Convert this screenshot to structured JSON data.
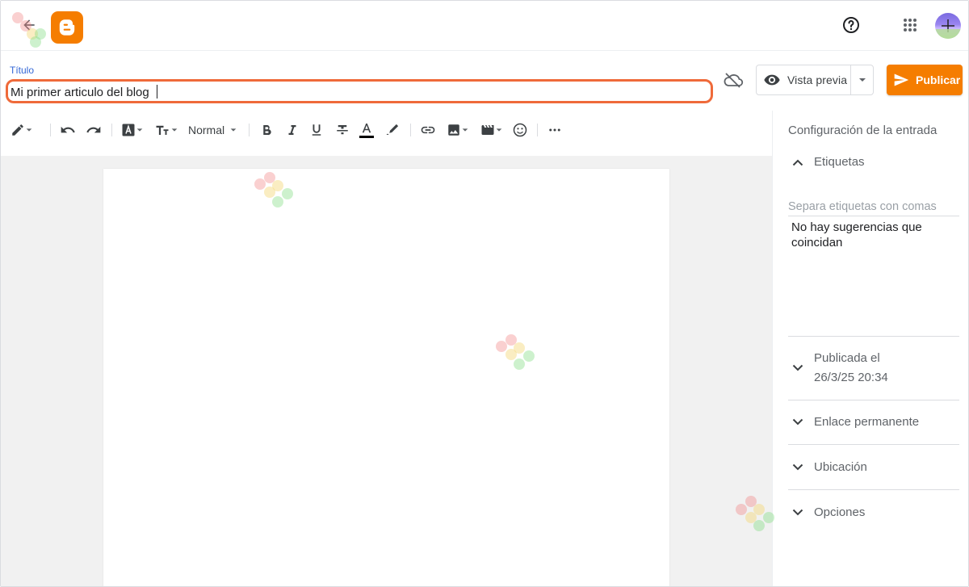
{
  "header": {
    "back_icon": "arrow-left-icon",
    "logo_icon": "blogger-logo-icon",
    "help_icon": "help-circle-icon",
    "apps_icon": "apps-grid-icon",
    "avatar_icon": "user-avatar"
  },
  "title_field": {
    "label": "Título",
    "value": "Mi primer articulo del blog",
    "highlight_color": "#ef6a3a"
  },
  "actions": {
    "cloud_icon": "cloud-off-icon",
    "preview_label": "Vista previa",
    "publish_label": "Publicar",
    "publish_color": "#f57d00"
  },
  "toolbar": {
    "items": [
      "pencil-icon",
      "undo-icon",
      "redo-icon",
      "font-icon",
      "text-size-icon",
      "bold-icon",
      "italic-icon",
      "underline-icon",
      "strikethrough-icon",
      "text-color-icon",
      "highlight-icon",
      "link-icon",
      "image-icon",
      "video-icon",
      "emoji-icon",
      "more-icon"
    ],
    "paragraph_style": "Normal"
  },
  "settings": {
    "title": "Configuración de la entrada",
    "labels_section": "Etiquetas",
    "labels_placeholder": "Separa etiquetas con comas",
    "no_suggestions": "No hay sugerencias que coincidan",
    "published_label": "Publicada el",
    "published_date": "26/3/25 20:34",
    "permalink": "Enlace permanente",
    "location": "Ubicación",
    "options": "Opciones"
  }
}
